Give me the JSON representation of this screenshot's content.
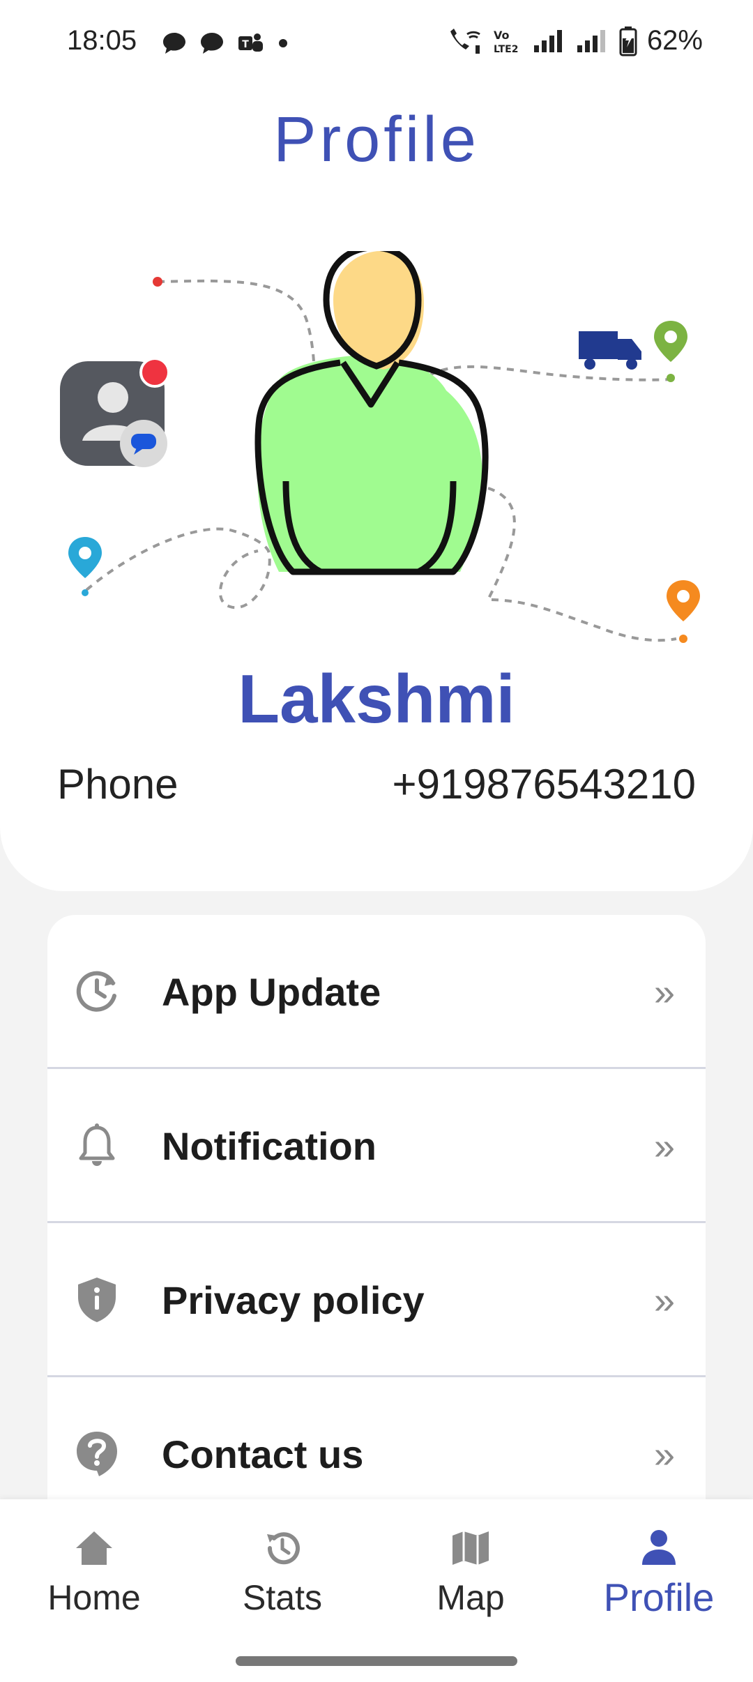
{
  "status_bar": {
    "time": "18:05",
    "battery_percent": "62%",
    "left_icons": [
      "chat-bubble-icon",
      "chat-bubble-icon",
      "teams-icon",
      "dot-icon"
    ],
    "right_icons": [
      "wifi-call-icon",
      "volte-icon",
      "signal-icon",
      "signal-icon",
      "battery-icon"
    ]
  },
  "header": {
    "title": "Profile"
  },
  "profile": {
    "name": "Lakshmi",
    "phone_label": "Phone",
    "phone_value": "+919876543210"
  },
  "menu": {
    "items": [
      {
        "label": "App Update",
        "icon": "update-clock-icon"
      },
      {
        "label": "Notification",
        "icon": "bell-icon"
      },
      {
        "label": "Privacy policy",
        "icon": "shield-icon"
      },
      {
        "label": "Contact us",
        "icon": "help-icon"
      }
    ],
    "chevron": "»"
  },
  "bottom_nav": {
    "items": [
      {
        "label": "Home",
        "icon": "home-icon"
      },
      {
        "label": "Stats",
        "icon": "history-icon"
      },
      {
        "label": "Map",
        "icon": "map-icon"
      },
      {
        "label": "Profile",
        "icon": "person-icon",
        "active": true
      }
    ]
  },
  "colors": {
    "accent": "#3f51b5",
    "avatar_head": "#fdd987",
    "avatar_body": "#a0fb90",
    "icon_gray": "#8a8a8a",
    "background": "#f3f3f3"
  }
}
